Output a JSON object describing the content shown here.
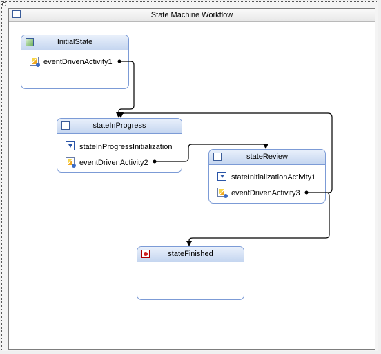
{
  "workflow": {
    "title": "State Machine Workflow"
  },
  "states": {
    "initial": {
      "title": "InitialState",
      "activities": [
        {
          "label": "eventDrivenActivity1"
        }
      ]
    },
    "inProgress": {
      "title": "stateInProgress",
      "activities": [
        {
          "label": "stateInProgressInitialization"
        },
        {
          "label": "eventDrivenActivity2"
        }
      ]
    },
    "review": {
      "title": "stateReview",
      "activities": [
        {
          "label": "stateInitializationActivity1"
        },
        {
          "label": "eventDrivenActivity3"
        }
      ]
    },
    "finished": {
      "title": "stateFinished"
    }
  },
  "colors": {
    "stateBorder": "#7c9bd6",
    "connector": "#000000"
  }
}
